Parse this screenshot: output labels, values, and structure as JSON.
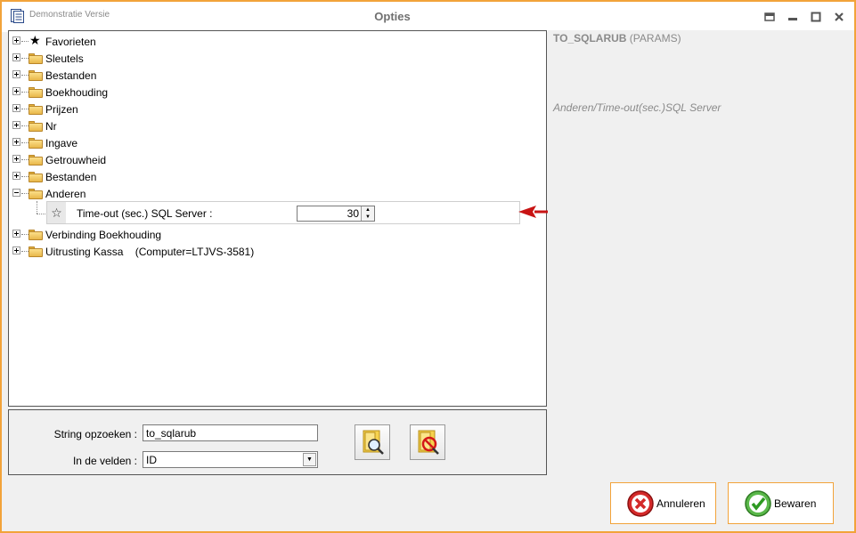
{
  "window": {
    "app_name": "Demonstratie Versie",
    "title": "Opties"
  },
  "tree": {
    "items_before": [
      {
        "label": "Favorieten",
        "icon": "star-icon"
      },
      {
        "label": "Sleutels",
        "icon": "folder-icon"
      },
      {
        "label": "Bestanden",
        "icon": "folder-icon"
      },
      {
        "label": "Boekhouding",
        "icon": "folder-icon"
      },
      {
        "label": "Prijzen",
        "icon": "folder-icon"
      },
      {
        "label": "Nr",
        "icon": "folder-icon"
      },
      {
        "label": "Ingave",
        "icon": "folder-icon"
      },
      {
        "label": "Getrouwheid",
        "icon": "folder-icon"
      },
      {
        "label": "Bestanden",
        "icon": "folder-icon"
      },
      {
        "label": "Anderen",
        "icon": "folder-icon",
        "expanded": true
      }
    ],
    "param": {
      "label": "Time-out (sec.) SQL Server :",
      "value": "30",
      "icon": "star-outline-icon"
    },
    "items_after": [
      {
        "label": "Verbinding Boekhouding",
        "icon": "folder-icon"
      },
      {
        "label": "Uitrusting Kassa    (Computer=LTJVS-3581)",
        "icon": "folder-icon"
      }
    ]
  },
  "info": {
    "param_id": "TO_SQLARUB",
    "param_group": "(PARAMS)",
    "param_path": "Anderen/Time-out(sec.)SQL Server"
  },
  "search": {
    "string_label": "String opzoeken :",
    "string_value": "to_sqlarub",
    "field_label": "In de velden :",
    "field_value": "ID"
  },
  "buttons": {
    "cancel": "Annuleren",
    "save": "Bewaren"
  },
  "colors": {
    "accent_border": "#f2a33a",
    "arrow": "#c81414"
  }
}
